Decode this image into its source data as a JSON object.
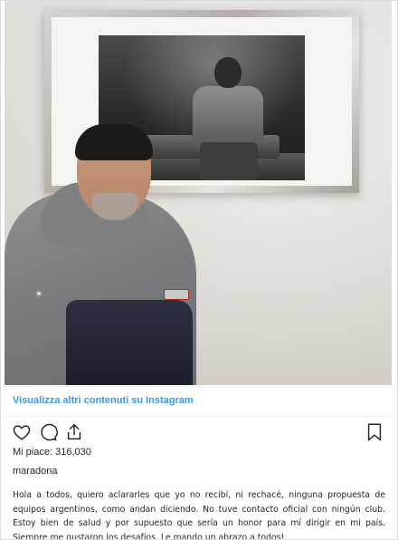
{
  "post": {
    "view_more_link": "Visualizza altri contenuti su Instagram",
    "likes_label": "Mi piace:",
    "likes_count": "316,030",
    "username": "maradona",
    "caption": "Hola a todos, quiero aclararles que yo no recibí, ni rechacé, ninguna propuesta de equipos argentinos, como andan diciendo. No tuve contacto oficial con ningún club. Estoy bien de salud y por supuesto que sería un honor para mí dirigir en mi país. Siempre me gustaron los desafíos. Le mando un abrazo a todos!"
  },
  "icons": {
    "like": "heart-icon",
    "comment": "comment-bubble-icon",
    "share": "share-icon",
    "save": "bookmark-icon"
  },
  "colors": {
    "link": "#3897f0",
    "text": "#262626",
    "border": "#dbdbdb"
  }
}
